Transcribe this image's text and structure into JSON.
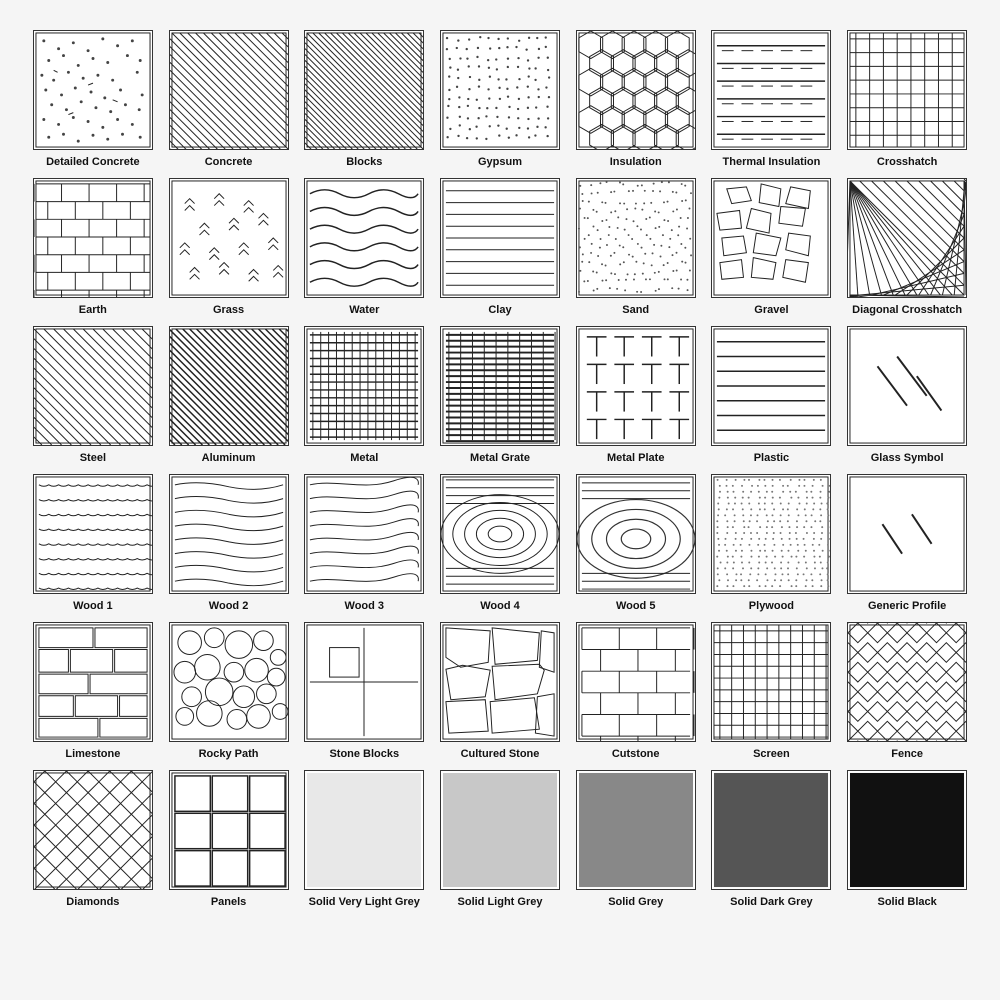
{
  "tiles": [
    {
      "id": "detailed-concrete",
      "label": "Detailed Concrete",
      "pattern": "detailed-concrete"
    },
    {
      "id": "concrete",
      "label": "Concrete",
      "pattern": "concrete"
    },
    {
      "id": "blocks",
      "label": "Blocks",
      "pattern": "blocks"
    },
    {
      "id": "gypsum",
      "label": "Gypsum",
      "pattern": "gypsum"
    },
    {
      "id": "insulation",
      "label": "Insulation",
      "pattern": "insulation"
    },
    {
      "id": "thermal-insulation",
      "label": "Thermal Insulation",
      "pattern": "thermal-insulation"
    },
    {
      "id": "crosshatch",
      "label": "Crosshatch",
      "pattern": "crosshatch"
    },
    {
      "id": "earth",
      "label": "Earth",
      "pattern": "earth"
    },
    {
      "id": "grass",
      "label": "Grass",
      "pattern": "grass"
    },
    {
      "id": "water",
      "label": "Water",
      "pattern": "water"
    },
    {
      "id": "clay",
      "label": "Clay",
      "pattern": "clay"
    },
    {
      "id": "sand",
      "label": "Sand",
      "pattern": "sand"
    },
    {
      "id": "gravel",
      "label": "Gravel",
      "pattern": "gravel"
    },
    {
      "id": "diagonal-crosshatch",
      "label": "Diagonal Crosshatch",
      "pattern": "diagonal-crosshatch"
    },
    {
      "id": "steel",
      "label": "Steel",
      "pattern": "steel"
    },
    {
      "id": "aluminum",
      "label": "Aluminum",
      "pattern": "aluminum"
    },
    {
      "id": "metal",
      "label": "Metal",
      "pattern": "metal"
    },
    {
      "id": "metal-grate",
      "label": "Metal Grate",
      "pattern": "metal-grate"
    },
    {
      "id": "metal-plate",
      "label": "Metal Plate",
      "pattern": "metal-plate"
    },
    {
      "id": "plastic",
      "label": "Plastic",
      "pattern": "plastic"
    },
    {
      "id": "glass-symbol",
      "label": "Glass Symbol",
      "pattern": "glass-symbol"
    },
    {
      "id": "wood1",
      "label": "Wood 1",
      "pattern": "wood1"
    },
    {
      "id": "wood2",
      "label": "Wood 2",
      "pattern": "wood2"
    },
    {
      "id": "wood3",
      "label": "Wood 3",
      "pattern": "wood3"
    },
    {
      "id": "wood4",
      "label": "Wood 4",
      "pattern": "wood4"
    },
    {
      "id": "wood5",
      "label": "Wood 5",
      "pattern": "wood5"
    },
    {
      "id": "plywood",
      "label": "Plywood",
      "pattern": "plywood"
    },
    {
      "id": "generic-profile",
      "label": "Generic Profile",
      "pattern": "generic-profile"
    },
    {
      "id": "limestone",
      "label": "Limestone",
      "pattern": "limestone"
    },
    {
      "id": "rocky-path",
      "label": "Rocky Path",
      "pattern": "rocky-path"
    },
    {
      "id": "stone-blocks",
      "label": "Stone Blocks",
      "pattern": "stone-blocks"
    },
    {
      "id": "cultured-stone",
      "label": "Cultured Stone",
      "pattern": "cultured-stone"
    },
    {
      "id": "cutstone",
      "label": "Cutstone",
      "pattern": "cutstone"
    },
    {
      "id": "screen",
      "label": "Screen",
      "pattern": "screen"
    },
    {
      "id": "fence",
      "label": "Fence",
      "pattern": "fence"
    },
    {
      "id": "diamonds",
      "label": "Diamonds",
      "pattern": "diamonds"
    },
    {
      "id": "panels",
      "label": "Panels",
      "pattern": "panels"
    },
    {
      "id": "solid-very-light-grey",
      "label": "Solid Very Light Grey",
      "pattern": "solid-very-light-grey"
    },
    {
      "id": "solid-light-grey",
      "label": "Solid Light Grey",
      "pattern": "solid-light-grey"
    },
    {
      "id": "solid-grey",
      "label": "Solid Grey",
      "pattern": "solid-grey"
    },
    {
      "id": "solid-dark-grey",
      "label": "Solid Dark Grey",
      "pattern": "solid-dark-grey"
    },
    {
      "id": "solid-black",
      "label": "Solid Black",
      "pattern": "solid-black"
    }
  ]
}
